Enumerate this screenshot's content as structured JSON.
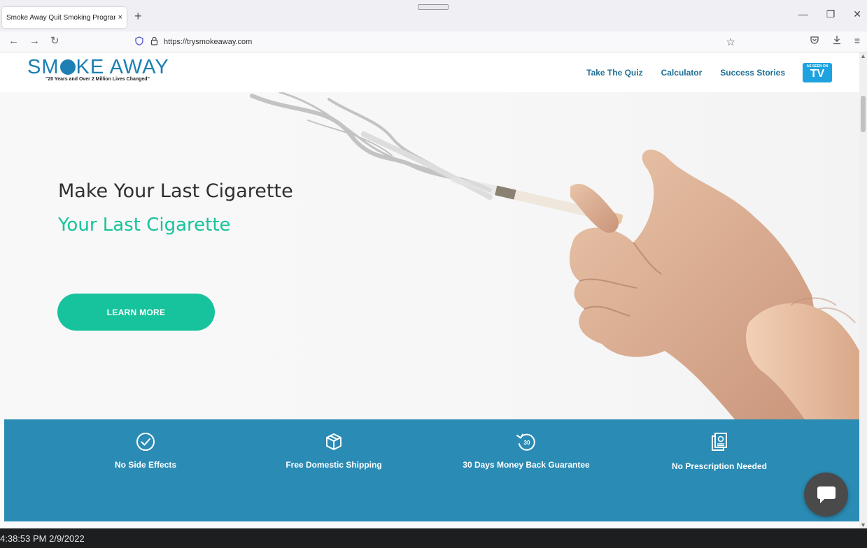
{
  "browser": {
    "tab_title": "Smoke Away Quit Smoking Program",
    "tab_close": "×",
    "new_tab": "+",
    "url": "https://trysmokeaway.com",
    "window_controls": [
      "—",
      "❐",
      "✕"
    ]
  },
  "site": {
    "logo_text_before": "SM",
    "logo_text_after": "KE AWAY",
    "logo_tagline": "\"20 Years and Over 2 Million Lives Changed\"",
    "nav": [
      "Take The Quiz",
      "Calculator",
      "Success Stories"
    ],
    "tv_badge_small": "AS SEEN ON",
    "tv_badge_big": "TV",
    "brand_color": "#1d7fb3",
    "accent_color": "#17c39c"
  },
  "hero": {
    "title": "Make Your Last Cigarette",
    "subtitle": "Your Last Cigarette",
    "cta": "LEARN MORE"
  },
  "features": [
    {
      "icon": "check-circle-icon",
      "label": "No Side Effects"
    },
    {
      "icon": "box-icon",
      "label": "Free Domestic Shipping"
    },
    {
      "icon": "refresh-30-icon",
      "label": "30 Days Money Back Guarantee",
      "badge": "30"
    },
    {
      "icon": "document-icon",
      "label": "No Prescription Needed"
    }
  ],
  "taskbar": {
    "clock": "4:38:53 PM 2/9/2022"
  }
}
